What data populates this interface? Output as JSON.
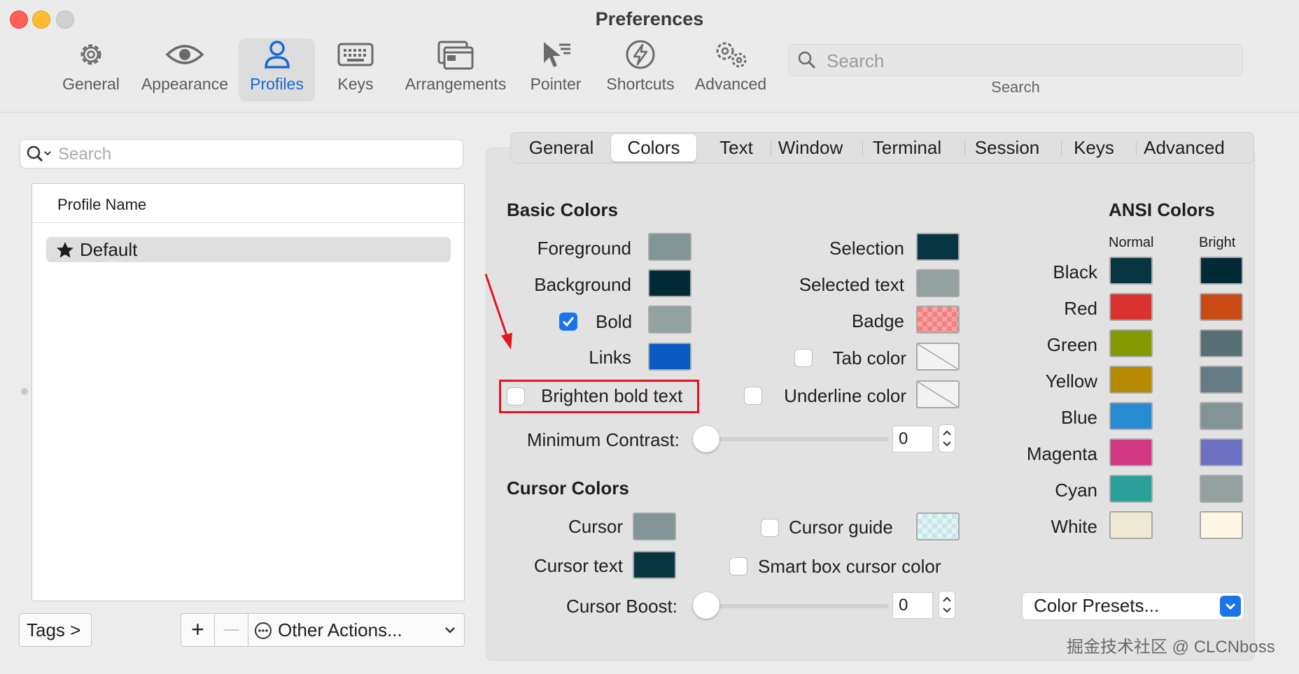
{
  "window": {
    "title": "Preferences"
  },
  "toolbar": {
    "items": [
      {
        "label": "General",
        "icon": "gear-icon"
      },
      {
        "label": "Appearance",
        "icon": "eye-icon"
      },
      {
        "label": "Profiles",
        "icon": "person-icon",
        "active": true
      },
      {
        "label": "Keys",
        "icon": "keyboard-icon"
      },
      {
        "label": "Arrangements",
        "icon": "windows-icon"
      },
      {
        "label": "Pointer",
        "icon": "pointer-icon"
      },
      {
        "label": "Shortcuts",
        "icon": "bolt-icon"
      },
      {
        "label": "Advanced",
        "icon": "gears-icon"
      }
    ],
    "search": {
      "placeholder": "Search",
      "label": "Search"
    }
  },
  "profiles": {
    "search_placeholder": "Search",
    "column_header": "Profile Name",
    "rows": [
      {
        "name": "Default",
        "icon": "star-icon"
      }
    ],
    "tags_button": "Tags >",
    "add": "+",
    "remove": "—",
    "other_actions": "Other Actions..."
  },
  "tabs": [
    "General",
    "Colors",
    "Text",
    "Window",
    "Terminal",
    "Session",
    "Keys",
    "Advanced"
  ],
  "selected_tab": "Colors",
  "basic_colors": {
    "title": "Basic Colors",
    "foreground": {
      "label": "Foreground",
      "color": "#839496"
    },
    "background": {
      "label": "Background",
      "color": "#002b36"
    },
    "bold": {
      "label": "Bold",
      "checked": true,
      "color": "#93a1a1"
    },
    "links": {
      "label": "Links",
      "color": "#0b5ac4"
    },
    "selection": {
      "label": "Selection",
      "color": "#073642"
    },
    "selected_text": {
      "label": "Selected text",
      "color": "#93a1a1"
    },
    "badge": {
      "label": "Badge",
      "color": "#f08080"
    },
    "tab_color": {
      "label": "Tab color",
      "checked": false
    },
    "brighten_bold": {
      "label": "Brighten bold text",
      "checked": false
    },
    "underline_color": {
      "label": "Underline color",
      "checked": false
    },
    "min_contrast": {
      "label": "Minimum Contrast:",
      "value": "0"
    }
  },
  "cursor_colors": {
    "title": "Cursor Colors",
    "cursor": {
      "label": "Cursor",
      "color": "#839496"
    },
    "cursor_text": {
      "label": "Cursor text",
      "color": "#073642"
    },
    "cursor_guide": {
      "label": "Cursor guide",
      "checked": false
    },
    "smart_box": {
      "label": "Smart box cursor color",
      "checked": false
    },
    "cursor_boost": {
      "label": "Cursor Boost:",
      "value": "0"
    }
  },
  "ansi": {
    "title": "ANSI Colors",
    "normal_header": "Normal",
    "bright_header": "Bright",
    "rows": [
      {
        "name": "Black",
        "normal": "#073642",
        "bright": "#002b36"
      },
      {
        "name": "Red",
        "normal": "#dc322f",
        "bright": "#cb4b16"
      },
      {
        "name": "Green",
        "normal": "#859900",
        "bright": "#586e75"
      },
      {
        "name": "Yellow",
        "normal": "#b58900",
        "bright": "#657b83"
      },
      {
        "name": "Blue",
        "normal": "#268bd2",
        "bright": "#839496"
      },
      {
        "name": "Magenta",
        "normal": "#d33682",
        "bright": "#6c71c4"
      },
      {
        "name": "Cyan",
        "normal": "#2aa198",
        "bright": "#93a1a1"
      },
      {
        "name": "White",
        "normal": "#eee8d5",
        "bright": "#fdf6e3"
      }
    ],
    "presets": "Color Presets..."
  },
  "watermark": "掘金技术社区 @ CLCNboss",
  "colors": {
    "accent": "#1a73e8",
    "highlight": "#e4161f"
  }
}
